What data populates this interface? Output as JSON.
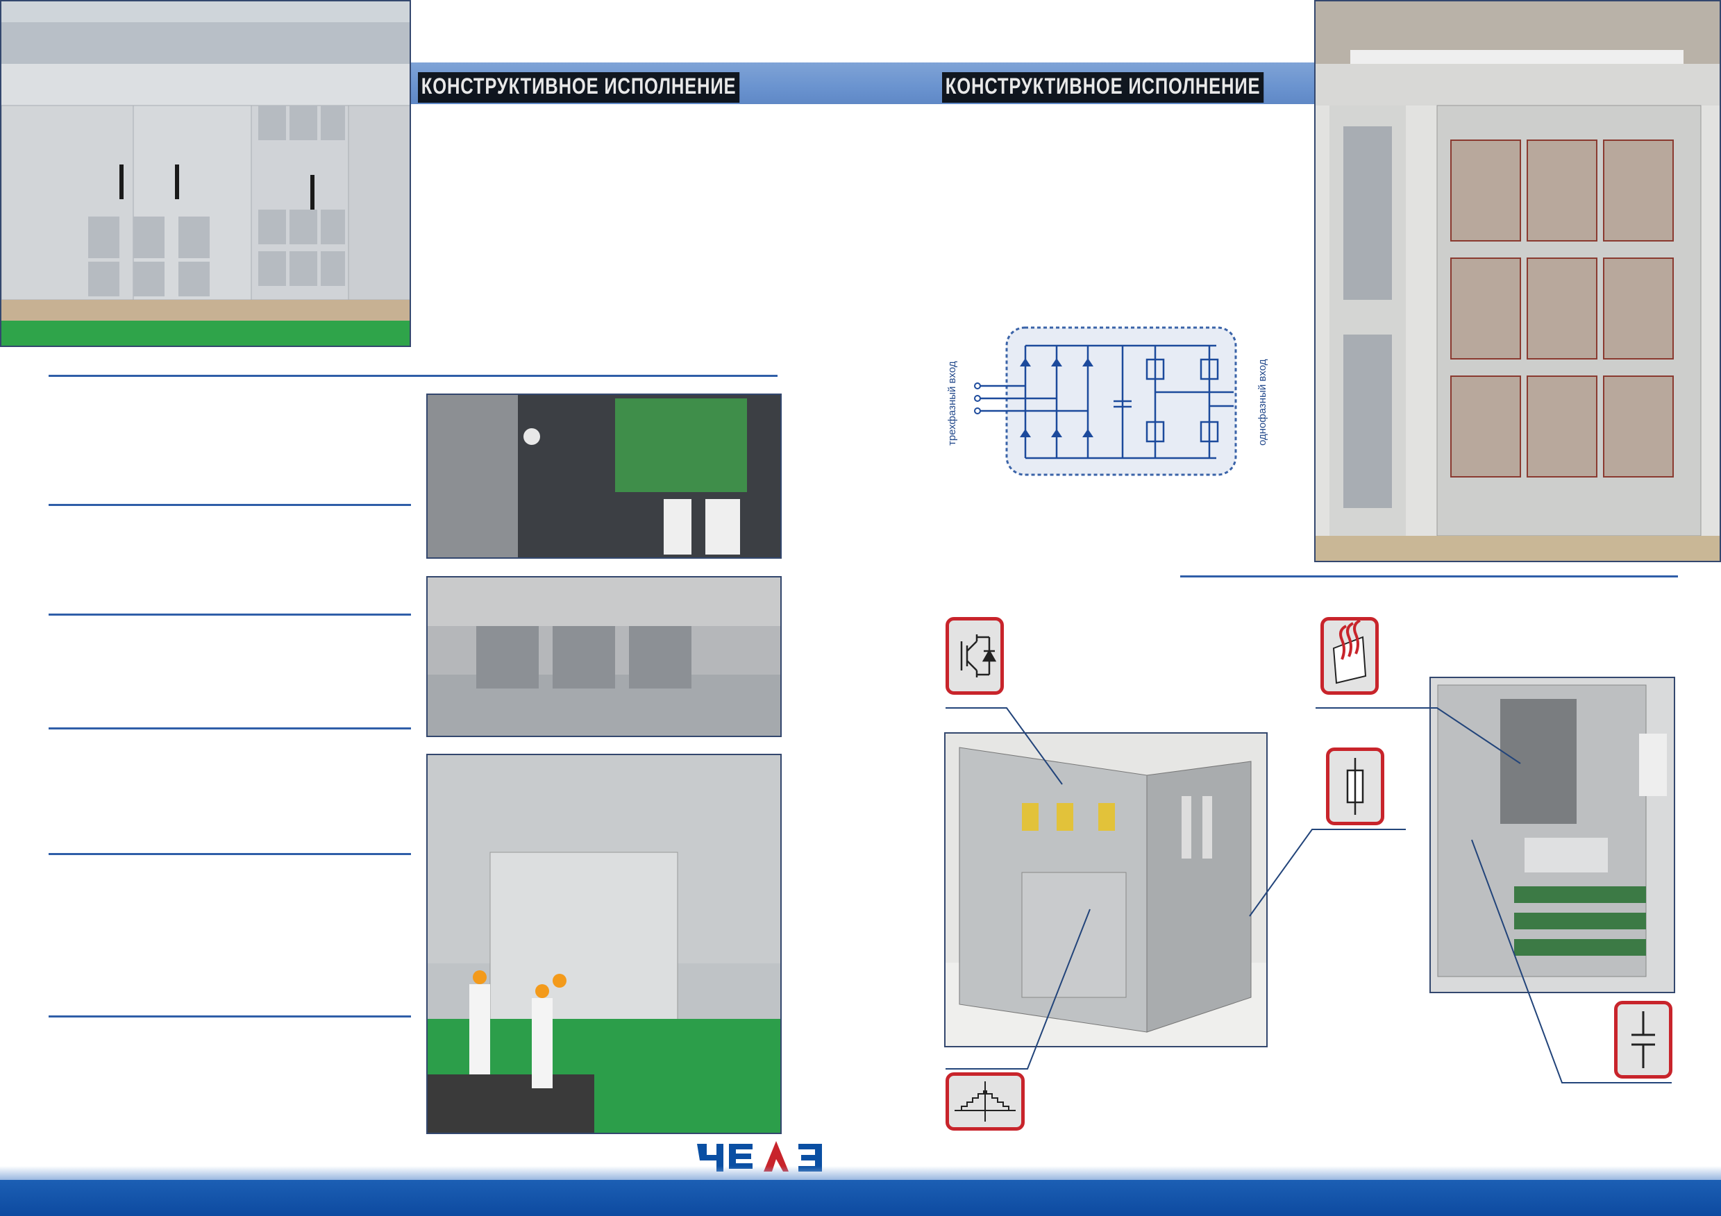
{
  "page": {
    "heading_left": "КОНСТРУКТИВНОЕ ИСПОЛНЕНИЕ",
    "heading_right": "КОНСТРУКТИВНОЕ ИСПОЛНЕНИЕ"
  },
  "diagram": {
    "label_input": "трехфазный вход",
    "label_output": "однофазный вход"
  },
  "logo": {
    "text_left": "ЧЭ",
    "text_right": "З"
  },
  "colors": {
    "band": "#6a93cf",
    "rule": "#2f5ea8",
    "icon_border": "#c8242b",
    "bottom_bar": "#0d4aa0"
  },
  "icons": [
    "igbt-icon",
    "heatsink-icon",
    "fuse-icon",
    "capacitor-icon",
    "waveform-icon"
  ]
}
